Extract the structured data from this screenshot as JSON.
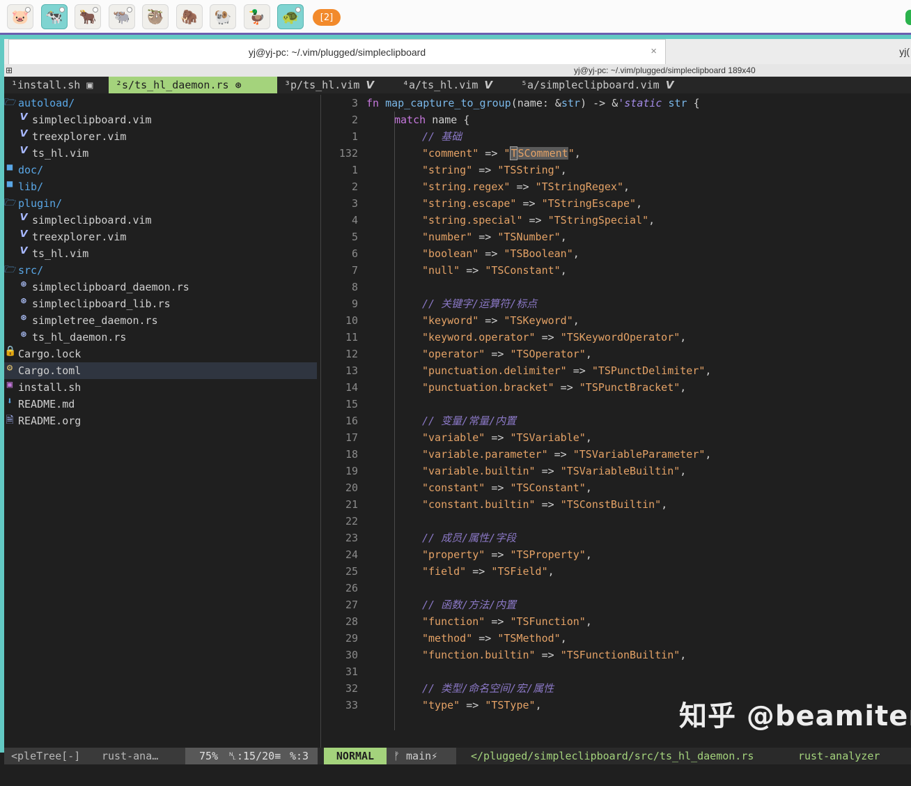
{
  "panel": {
    "apps": [
      "🐷",
      "🐄",
      "🐂",
      "🐃",
      "🦥",
      "🦣",
      "🐏",
      "🦆",
      "🐢"
    ],
    "app_names": [
      "pig-icon",
      "cow-icon",
      "ox-icon",
      "water-buffalo-icon",
      "sloth-icon",
      "mammoth-icon",
      "ram-icon",
      "duck-icon",
      "turtle-icon"
    ],
    "badge": "[2]"
  },
  "window": {
    "tab_title": "yj@yj-pc: ~/.vim/plugged/simpleclipboard",
    "tab2_title": "yj(",
    "close_glyph": "×",
    "terminal_title": "yj@yj-pc: ~/.vim/plugged/simpleclipboard 189x40"
  },
  "vim": {
    "tabs": [
      {
        "label": "¹install.sh ▣",
        "active": false
      },
      {
        "label": "²s/ts_hl_daemon.rs ⊛",
        "active": true
      },
      {
        "label": "³p/ts_hl.vim 𝙑",
        "active": false
      },
      {
        "label": "⁴a/ts_hl.vim 𝙑",
        "active": false
      },
      {
        "label": "⁵a/simpleclipboard.vim 𝙑",
        "active": false
      }
    ],
    "tree": [
      {
        "indent": 0,
        "icon": "🗁",
        "icon_name": "folder-open-icon",
        "label": "autoload/",
        "dir": true
      },
      {
        "indent": 1,
        "icon": "𝙑",
        "icon_name": "vim-file-icon",
        "label": "simpleclipboard.vim",
        "dir": false
      },
      {
        "indent": 1,
        "icon": "𝙑",
        "icon_name": "vim-file-icon",
        "label": "treexplorer.vim",
        "dir": false
      },
      {
        "indent": 1,
        "icon": "𝙑",
        "icon_name": "vim-file-icon",
        "label": "ts_hl.vim",
        "dir": false
      },
      {
        "indent": 0,
        "icon": "■",
        "icon_name": "folder-icon",
        "label": "doc/",
        "dir": true
      },
      {
        "indent": 0,
        "icon": "■",
        "icon_name": "folder-icon",
        "label": "lib/",
        "dir": true
      },
      {
        "indent": 0,
        "icon": "🗁",
        "icon_name": "folder-open-icon",
        "label": "plugin/",
        "dir": true
      },
      {
        "indent": 1,
        "icon": "𝙑",
        "icon_name": "vim-file-icon",
        "label": "simpleclipboard.vim",
        "dir": false
      },
      {
        "indent": 1,
        "icon": "𝙑",
        "icon_name": "vim-file-icon",
        "label": "treexplorer.vim",
        "dir": false
      },
      {
        "indent": 1,
        "icon": "𝙑",
        "icon_name": "vim-file-icon",
        "label": "ts_hl.vim",
        "dir": false
      },
      {
        "indent": 0,
        "icon": "🗁",
        "icon_name": "folder-open-icon",
        "label": "src/",
        "dir": true
      },
      {
        "indent": 1,
        "icon": "⊛",
        "icon_name": "rust-file-icon",
        "label": "simpleclipboard_daemon.rs",
        "dir": false
      },
      {
        "indent": 1,
        "icon": "⊛",
        "icon_name": "rust-file-icon",
        "label": "simpleclipboard_lib.rs",
        "dir": false
      },
      {
        "indent": 1,
        "icon": "⊛",
        "icon_name": "rust-file-icon",
        "label": "simpletree_daemon.rs",
        "dir": false
      },
      {
        "indent": 1,
        "icon": "⊛",
        "icon_name": "rust-file-icon",
        "label": "ts_hl_daemon.rs",
        "dir": false
      },
      {
        "indent": 0,
        "icon": "🔒",
        "icon_name": "lock-icon",
        "label": "Cargo.lock",
        "dir": false
      },
      {
        "indent": 0,
        "icon": "⚙",
        "icon_name": "gear-icon",
        "label": "Cargo.toml",
        "dir": false
      },
      {
        "indent": 0,
        "icon": "▣",
        "icon_name": "shell-script-icon",
        "label": "install.sh",
        "dir": false
      },
      {
        "indent": 0,
        "icon": "⬇",
        "icon_name": "markdown-icon",
        "label": "README.md",
        "dir": false
      },
      {
        "indent": 0,
        "icon": "🗎",
        "icon_name": "document-icon",
        "label": "README.org",
        "dir": false
      }
    ],
    "code": [
      {
        "ln": "3",
        "segs": [
          [
            "fn ",
            "kw"
          ],
          [
            "map_capture_to_group",
            "fn"
          ],
          [
            "(name: &",
            "p"
          ],
          [
            "str",
            "ty"
          ],
          [
            ") -> &",
            "p"
          ],
          [
            "'static",
            "lt"
          ],
          [
            " ",
            "p"
          ],
          [
            "str",
            "ty"
          ],
          [
            " {",
            "p"
          ]
        ],
        "indent": 0
      },
      {
        "ln": "2",
        "segs": [
          [
            "match ",
            "kw"
          ],
          [
            "name {",
            "p"
          ]
        ],
        "indent": 1
      },
      {
        "ln": "1",
        "segs": [
          [
            "// 基础",
            "cmt"
          ]
        ],
        "indent": 2
      },
      {
        "ln": "132",
        "segs": [
          [
            "\"comment\"",
            "str"
          ],
          [
            " => ",
            "p"
          ],
          [
            "\"",
            "str"
          ],
          [
            "T",
            "cur"
          ],
          [
            "SComment",
            "curstr"
          ],
          [
            "\"",
            "str"
          ],
          [
            ",",
            "p"
          ]
        ],
        "indent": 2
      },
      {
        "ln": "1",
        "segs": [
          [
            "\"string\"",
            "str"
          ],
          [
            " => ",
            "p"
          ],
          [
            "\"TSString\"",
            "str"
          ],
          [
            ",",
            "p"
          ]
        ],
        "indent": 2
      },
      {
        "ln": "2",
        "segs": [
          [
            "\"string.regex\"",
            "str"
          ],
          [
            " => ",
            "p"
          ],
          [
            "\"TStringRegex\"",
            "str"
          ],
          [
            ",",
            "p"
          ]
        ],
        "indent": 2
      },
      {
        "ln": "3",
        "segs": [
          [
            "\"string.escape\"",
            "str"
          ],
          [
            " => ",
            "p"
          ],
          [
            "\"TStringEscape\"",
            "str"
          ],
          [
            ",",
            "p"
          ]
        ],
        "indent": 2
      },
      {
        "ln": "4",
        "segs": [
          [
            "\"string.special\"",
            "str"
          ],
          [
            " => ",
            "p"
          ],
          [
            "\"TStringSpecial\"",
            "str"
          ],
          [
            ",",
            "p"
          ]
        ],
        "indent": 2
      },
      {
        "ln": "5",
        "segs": [
          [
            "\"number\"",
            "str"
          ],
          [
            " => ",
            "p"
          ],
          [
            "\"TSNumber\"",
            "str"
          ],
          [
            ",",
            "p"
          ]
        ],
        "indent": 2
      },
      {
        "ln": "6",
        "segs": [
          [
            "\"boolean\"",
            "str"
          ],
          [
            " => ",
            "p"
          ],
          [
            "\"TSBoolean\"",
            "str"
          ],
          [
            ",",
            "p"
          ]
        ],
        "indent": 2
      },
      {
        "ln": "7",
        "segs": [
          [
            "\"null\"",
            "str"
          ],
          [
            " => ",
            "p"
          ],
          [
            "\"TSConstant\"",
            "str"
          ],
          [
            ",",
            "p"
          ]
        ],
        "indent": 2
      },
      {
        "ln": "8",
        "segs": [],
        "indent": 2
      },
      {
        "ln": "9",
        "segs": [
          [
            "// 关键字/运算符/标点",
            "cmt"
          ]
        ],
        "indent": 2
      },
      {
        "ln": "10",
        "segs": [
          [
            "\"keyword\"",
            "str"
          ],
          [
            " => ",
            "p"
          ],
          [
            "\"TSKeyword\"",
            "str"
          ],
          [
            ",",
            "p"
          ]
        ],
        "indent": 2
      },
      {
        "ln": "11",
        "segs": [
          [
            "\"keyword.operator\"",
            "str"
          ],
          [
            " => ",
            "p"
          ],
          [
            "\"TSKeywordOperator\"",
            "str"
          ],
          [
            ",",
            "p"
          ]
        ],
        "indent": 2
      },
      {
        "ln": "12",
        "segs": [
          [
            "\"operator\"",
            "str"
          ],
          [
            " => ",
            "p"
          ],
          [
            "\"TSOperator\"",
            "str"
          ],
          [
            ",",
            "p"
          ]
        ],
        "indent": 2
      },
      {
        "ln": "13",
        "segs": [
          [
            "\"punctuation.delimiter\"",
            "str"
          ],
          [
            " => ",
            "p"
          ],
          [
            "\"TSPunctDelimiter\"",
            "str"
          ],
          [
            ",",
            "p"
          ]
        ],
        "indent": 2
      },
      {
        "ln": "14",
        "segs": [
          [
            "\"punctuation.bracket\"",
            "str"
          ],
          [
            " => ",
            "p"
          ],
          [
            "\"TSPunctBracket\"",
            "str"
          ],
          [
            ",",
            "p"
          ]
        ],
        "indent": 2
      },
      {
        "ln": "15",
        "segs": [],
        "indent": 2
      },
      {
        "ln": "16",
        "segs": [
          [
            "// 变量/常量/内置",
            "cmt"
          ]
        ],
        "indent": 2
      },
      {
        "ln": "17",
        "segs": [
          [
            "\"variable\"",
            "str"
          ],
          [
            " => ",
            "p"
          ],
          [
            "\"TSVariable\"",
            "str"
          ],
          [
            ",",
            "p"
          ]
        ],
        "indent": 2
      },
      {
        "ln": "18",
        "segs": [
          [
            "\"variable.parameter\"",
            "str"
          ],
          [
            " => ",
            "p"
          ],
          [
            "\"TSVariableParameter\"",
            "str"
          ],
          [
            ",",
            "p"
          ]
        ],
        "indent": 2
      },
      {
        "ln": "19",
        "segs": [
          [
            "\"variable.builtin\"",
            "str"
          ],
          [
            " => ",
            "p"
          ],
          [
            "\"TSVariableBuiltin\"",
            "str"
          ],
          [
            ",",
            "p"
          ]
        ],
        "indent": 2
      },
      {
        "ln": "20",
        "segs": [
          [
            "\"constant\"",
            "str"
          ],
          [
            " => ",
            "p"
          ],
          [
            "\"TSConstant\"",
            "str"
          ],
          [
            ",",
            "p"
          ]
        ],
        "indent": 2
      },
      {
        "ln": "21",
        "segs": [
          [
            "\"constant.builtin\"",
            "str"
          ],
          [
            " => ",
            "p"
          ],
          [
            "\"TSConstBuiltin\"",
            "str"
          ],
          [
            ",",
            "p"
          ]
        ],
        "indent": 2
      },
      {
        "ln": "22",
        "segs": [],
        "indent": 2
      },
      {
        "ln": "23",
        "segs": [
          [
            "// 成员/属性/字段",
            "cmt"
          ]
        ],
        "indent": 2
      },
      {
        "ln": "24",
        "segs": [
          [
            "\"property\"",
            "str"
          ],
          [
            " => ",
            "p"
          ],
          [
            "\"TSProperty\"",
            "str"
          ],
          [
            ",",
            "p"
          ]
        ],
        "indent": 2
      },
      {
        "ln": "25",
        "segs": [
          [
            "\"field\"",
            "str"
          ],
          [
            " => ",
            "p"
          ],
          [
            "\"TSField\"",
            "str"
          ],
          [
            ",",
            "p"
          ]
        ],
        "indent": 2
      },
      {
        "ln": "26",
        "segs": [],
        "indent": 2
      },
      {
        "ln": "27",
        "segs": [
          [
            "// 函数/方法/内置",
            "cmt"
          ]
        ],
        "indent": 2
      },
      {
        "ln": "28",
        "segs": [
          [
            "\"function\"",
            "str"
          ],
          [
            " => ",
            "p"
          ],
          [
            "\"TSFunction\"",
            "str"
          ],
          [
            ",",
            "p"
          ]
        ],
        "indent": 2
      },
      {
        "ln": "29",
        "segs": [
          [
            "\"method\"",
            "str"
          ],
          [
            " => ",
            "p"
          ],
          [
            "\"TSMethod\"",
            "str"
          ],
          [
            ",",
            "p"
          ]
        ],
        "indent": 2
      },
      {
        "ln": "30",
        "segs": [
          [
            "\"function.builtin\"",
            "str"
          ],
          [
            " => ",
            "p"
          ],
          [
            "\"TSFunctionBuiltin\"",
            "str"
          ],
          [
            ",",
            "p"
          ]
        ],
        "indent": 2
      },
      {
        "ln": "31",
        "segs": [],
        "indent": 2
      },
      {
        "ln": "32",
        "segs": [
          [
            "// 类型/命名空间/宏/属性",
            "cmt"
          ]
        ],
        "indent": 2
      },
      {
        "ln": "33",
        "segs": [
          [
            "\"type\"",
            "str"
          ],
          [
            " => ",
            "p"
          ],
          [
            "\"TSType\"",
            "str"
          ],
          [
            ",",
            "p"
          ]
        ],
        "indent": 2
      }
    ],
    "status_left": {
      "buffer": "<pleTree[-]",
      "filetype": "rust-ana…",
      "percent": "75%",
      "pos": "␤:15/20≡",
      "col": "%:3"
    },
    "status_right": {
      "mode": "NORMAL",
      "branch": "ᚠ main⚡",
      "path": "</plugged/simpleclipboard/src/ts_hl_daemon.rs",
      "lsp": "rust-analyzer"
    }
  },
  "watermark": "知乎 @beamiter",
  "colors": {
    "accent": "#62c9c3",
    "mode_bg": "#a4d37c",
    "string": "#e4a266",
    "comment": "#8b78c6",
    "keyword": "#c678dd"
  }
}
